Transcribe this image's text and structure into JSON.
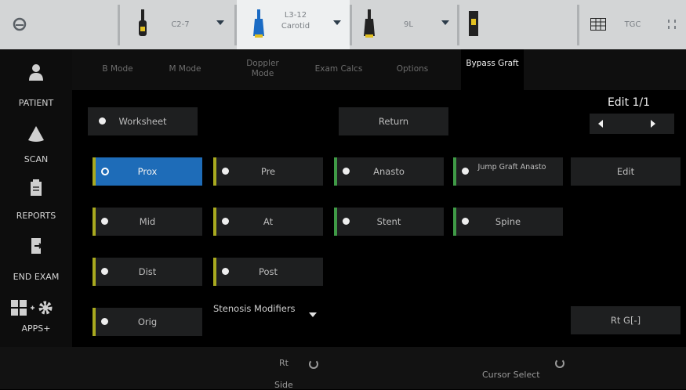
{
  "topbar": {
    "probes": [
      {
        "name": "C2-7",
        "sub": ""
      },
      {
        "name": "L3-12",
        "sub": "Carotid"
      },
      {
        "name": "9L",
        "sub": ""
      }
    ],
    "tgc_label": "TGC"
  },
  "nav": {
    "items": [
      {
        "label": "PATIENT",
        "icon": "patient-icon"
      },
      {
        "label": "SCAN",
        "icon": "scan-icon"
      },
      {
        "label": "REPORTS",
        "icon": "reports-icon"
      },
      {
        "label": "END EXAM",
        "icon": "end-exam-icon"
      },
      {
        "label": "APPS+",
        "icon": "apps-icon"
      }
    ]
  },
  "tabs": [
    "B Mode",
    "M Mode",
    "Doppler Mode",
    "Exam Calcs",
    "Options",
    "Bypass Graft"
  ],
  "panel": {
    "worksheet": "Worksheet",
    "return": "Return",
    "edit_page": "Edit 1/1",
    "edit": "Edit",
    "col1": [
      "Prox",
      "Mid",
      "Dist",
      "Orig"
    ],
    "col2": [
      "Pre",
      "At",
      "Post"
    ],
    "col3": [
      "Anasto",
      "Stent"
    ],
    "col4": [
      "Jump Graft Anasto",
      "Spine"
    ],
    "stenosis": "Stenosis Modifiers",
    "rt_g": "Rt G[-]"
  },
  "bottombar": {
    "rt_side_top": "Rt",
    "rt_side_bottom": "Side",
    "cursor_select": "Cursor Select"
  },
  "colors": {
    "selected": "#1e6cb8",
    "indicator_yellow": "#a8a91f",
    "indicator_green": "#3f9a46"
  }
}
